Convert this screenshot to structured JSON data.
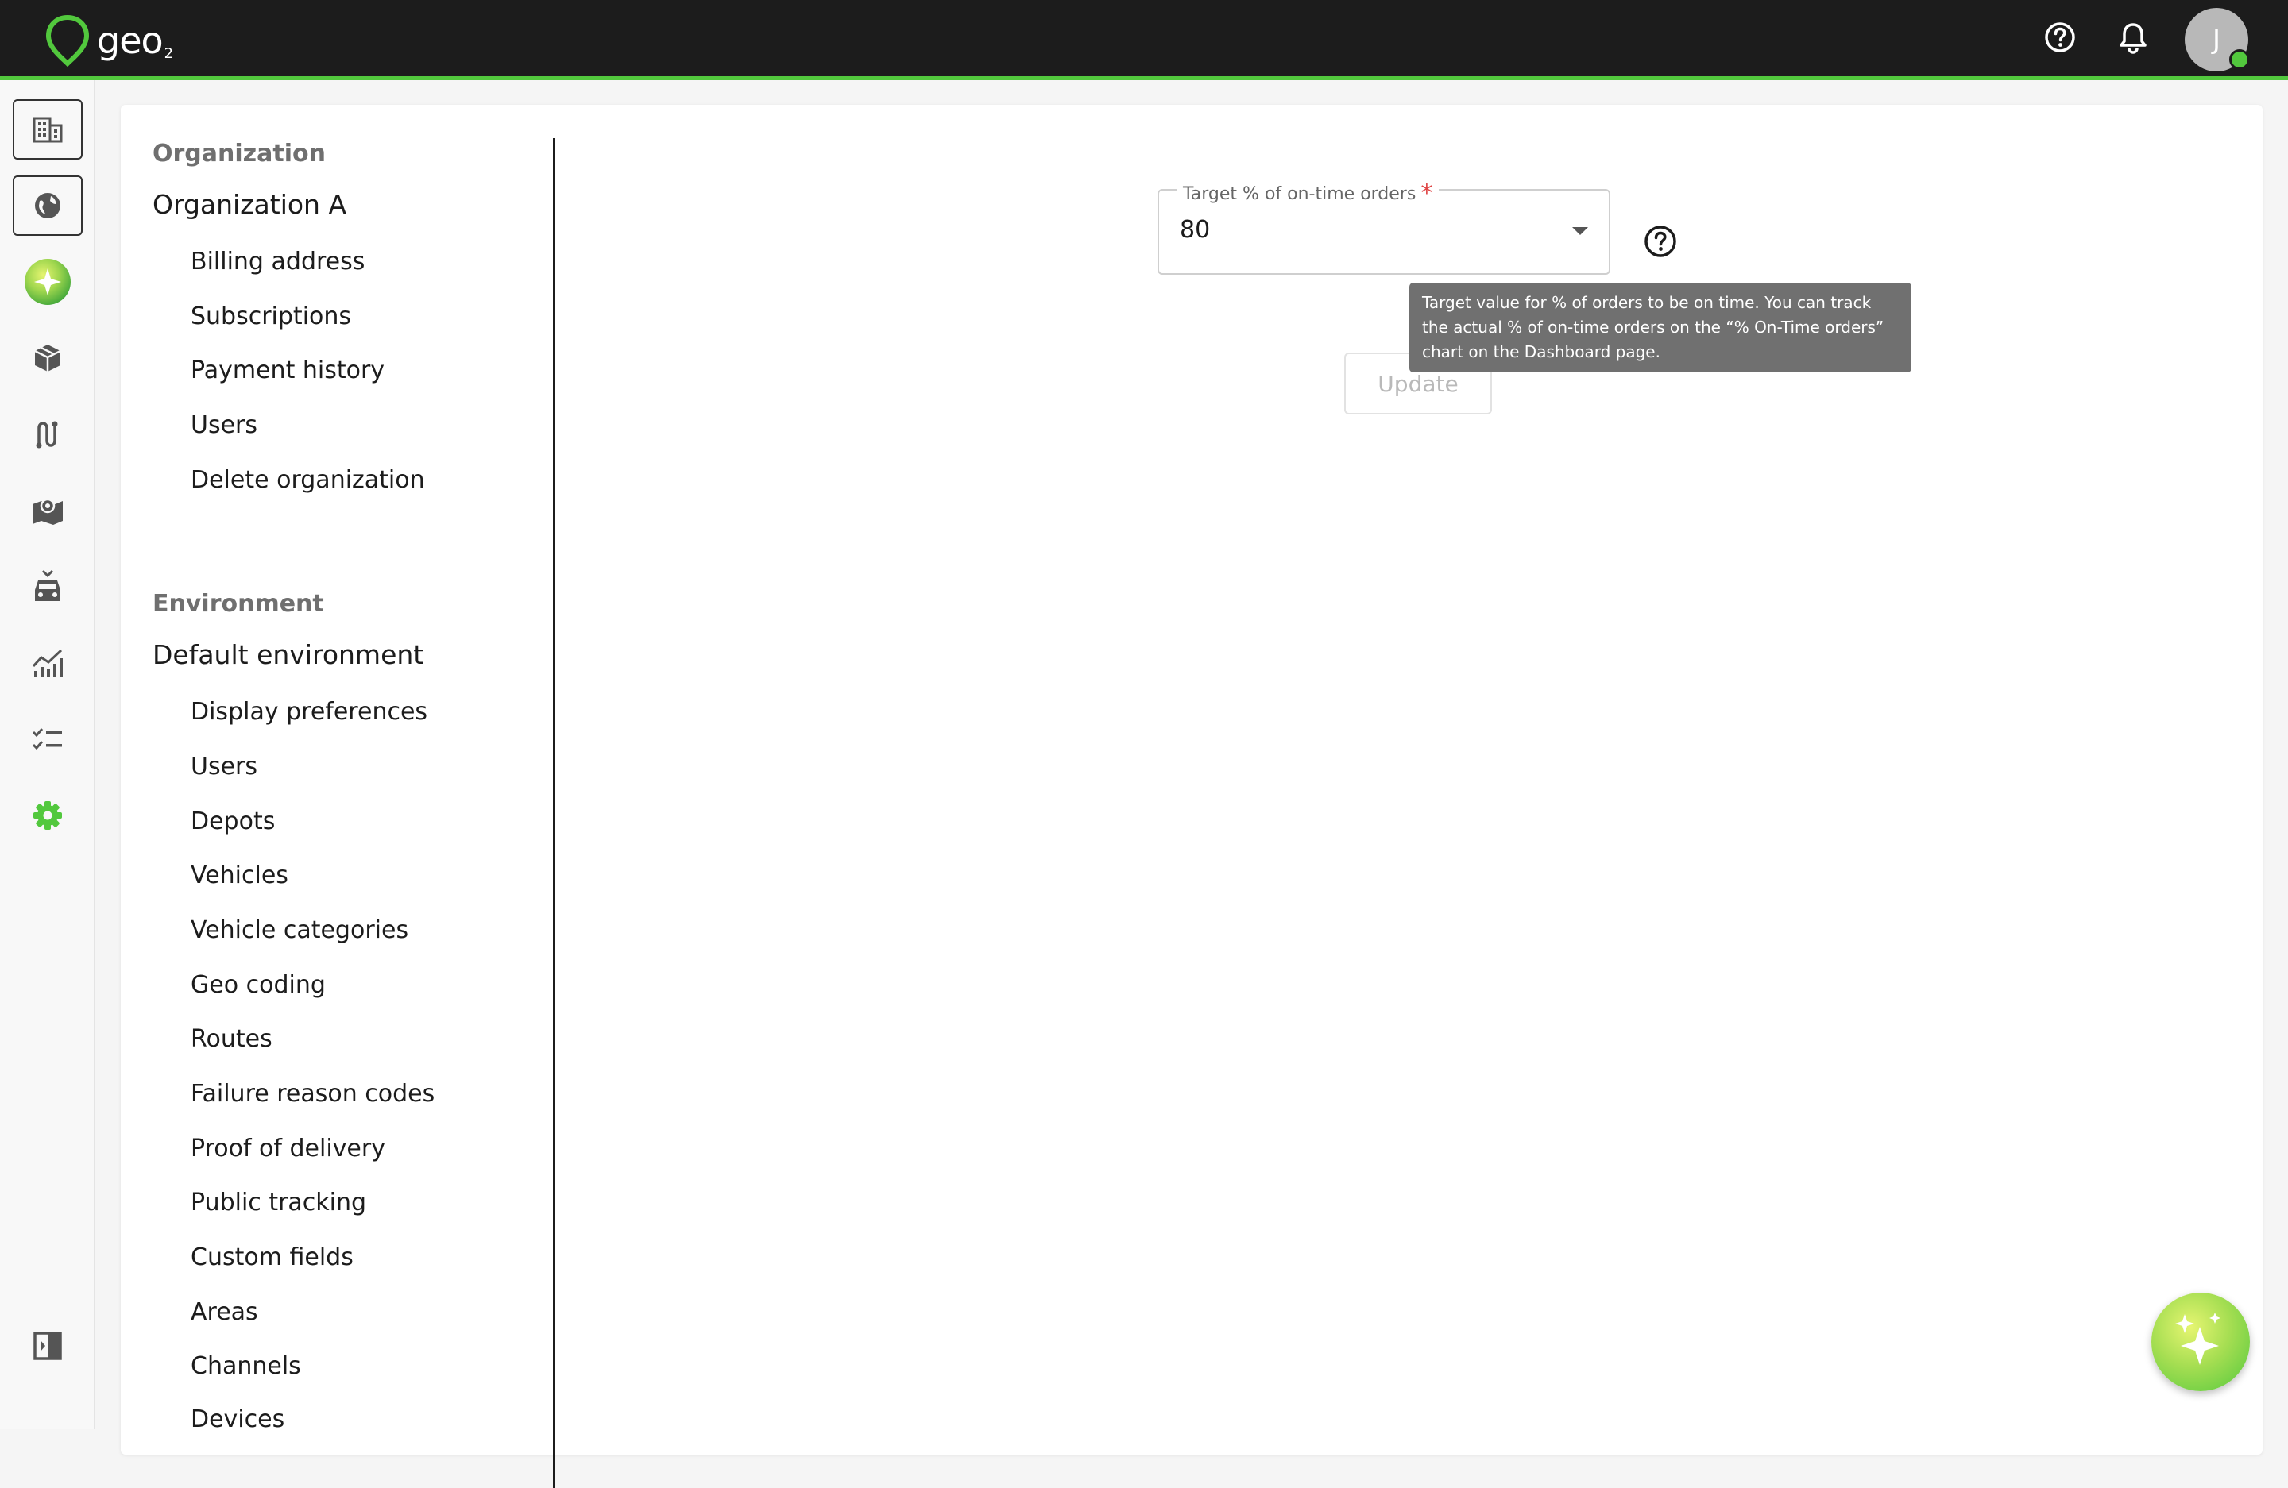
{
  "header": {
    "logo_text": "geo",
    "logo_sub": "2",
    "avatar_initial": "J",
    "icons": [
      "help-circle-icon",
      "bell-icon"
    ]
  },
  "rail": {
    "items": [
      {
        "name": "organization",
        "icon": "building-icon"
      },
      {
        "name": "environment",
        "icon": "globe-icon"
      },
      {
        "name": "ai-assistant",
        "icon": "sparkle-icon"
      },
      {
        "name": "orders",
        "icon": "package-icon"
      },
      {
        "name": "routes",
        "icon": "route-icon"
      },
      {
        "name": "map",
        "icon": "map-icon"
      },
      {
        "name": "vehicles",
        "icon": "car-icon"
      },
      {
        "name": "analytics",
        "icon": "chart-icon"
      },
      {
        "name": "tasks",
        "icon": "checklist-icon"
      },
      {
        "name": "settings",
        "icon": "gear-icon"
      },
      {
        "name": "collapse",
        "icon": "sidebar-toggle-icon"
      }
    ]
  },
  "settings_nav": {
    "organization_heading": "Organization",
    "organization_name": "Organization A",
    "organization_links": [
      "Billing address",
      "Subscriptions",
      "Payment history",
      "Users",
      "Delete organization"
    ],
    "environment_heading": "Environment",
    "environment_name": "Default environment",
    "environment_links": [
      "Display preferences",
      "Users",
      "Depots",
      "Vehicles",
      "Vehicle categories",
      "Geo coding",
      "Routes",
      "Failure reason codes",
      "Proof of delivery",
      "Public tracking",
      "Custom fields",
      "Areas",
      "Channels",
      "Devices"
    ]
  },
  "form": {
    "field_label": "Target % of on-time orders",
    "required_mark": "*",
    "field_value": "80",
    "tooltip": "Target value for % of orders to be on time. You can track the actual % of on-time orders on the “% On-Time orders” chart on the Dashboard page.",
    "update_label": "Update"
  },
  "colors": {
    "accent": "#52c83d",
    "topbar": "#1c1c1c",
    "required": "#e04646"
  }
}
